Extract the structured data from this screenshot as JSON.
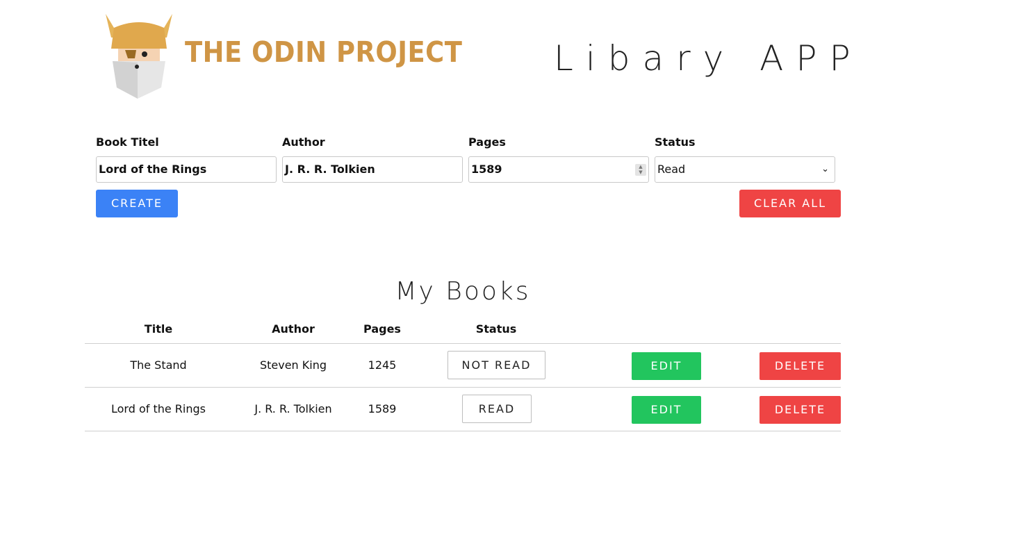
{
  "header": {
    "logo_text": "THE ODIN PROJECT",
    "app_title": "Libary APP"
  },
  "form": {
    "title_label": "Book Titel",
    "title_value": "Lord of the Rings",
    "author_label": "Author",
    "author_value": "J. R. R. Tolkien",
    "pages_label": "Pages",
    "pages_value": "1589",
    "status_label": "Status",
    "status_value": "Read",
    "create_label": "CREATE",
    "clear_label": "CLEAR ALL"
  },
  "books": {
    "heading": "My Books",
    "columns": [
      "Title",
      "Author",
      "Pages",
      "Status"
    ],
    "rows": [
      {
        "title": "The Stand",
        "author": "Steven King",
        "pages": "1245",
        "status": "NOT READ",
        "edit": "EDIT",
        "delete": "DELETE"
      },
      {
        "title": "Lord of the Rings",
        "author": "J. R. R. Tolkien",
        "pages": "1589",
        "status": "READ",
        "edit": "EDIT",
        "delete": "DELETE"
      }
    ]
  },
  "colors": {
    "brand_gold": "#cf9545",
    "create_blue": "#3b82f6",
    "danger_red": "#ef4444",
    "edit_green": "#22c55e"
  }
}
